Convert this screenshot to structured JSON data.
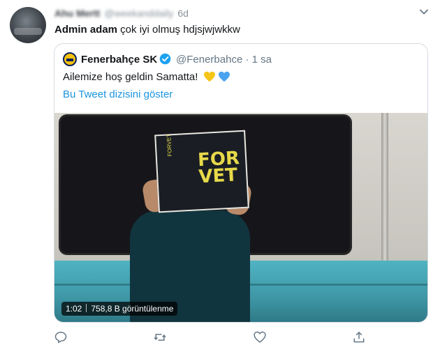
{
  "outer_tweet": {
    "display_name": "Ahu Mertt",
    "handle": "@weekanddaily",
    "time": "6d",
    "mention": "Admin adam",
    "text": " çok iyi olmuş hdjsjwjwkkw"
  },
  "quoted_tweet": {
    "display_name": "Fenerbahçe SK",
    "handle_time": "@Fenerbahce · 1 sa",
    "text": "Ailemize hoş geldin Samatta!",
    "thread_link": "Bu Tweet dizisini göster",
    "book_title_line1": "FOR",
    "book_title_line2": "VET",
    "book_spine": "FORVET",
    "video_duration": "1:02",
    "video_views": "758,8 B görüntülenme"
  },
  "colors": {
    "link": "#1b95e0",
    "secondary_text": "#657786",
    "verified": "#1da1f2",
    "heart_yellow": "#f5c518",
    "heart_blue": "#4aa3ef"
  },
  "icons": {
    "caret": "chevron-down-icon",
    "reply": "reply-icon",
    "retweet": "retweet-icon",
    "like": "heart-icon",
    "share": "share-icon"
  }
}
